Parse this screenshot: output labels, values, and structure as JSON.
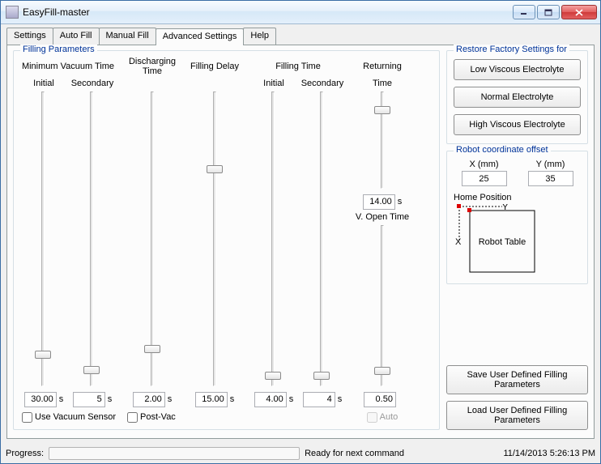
{
  "window": {
    "title": "EasyFill-master"
  },
  "tabs": {
    "items": [
      "Settings",
      "Auto Fill",
      "Manual Fill",
      "Advanced Settings",
      "Help"
    ],
    "active": "Advanced Settings"
  },
  "filling_parameters": {
    "legend": "Filling Parameters",
    "groups": {
      "min_vacuum": {
        "title": "Minimum Vacuum Time",
        "initial_label": "Initial",
        "secondary_label": "Secondary",
        "initial_value": "30.00",
        "secondary_value": "5",
        "unit": "s",
        "checkbox_label": "Use Vacuum Sensor",
        "checkbox_checked": false,
        "initial_slider_pct": 88,
        "secondary_slider_pct": 93
      },
      "discharging": {
        "title": "Discharging Time",
        "value": "2.00",
        "unit": "s",
        "checkbox_label": "Post-Vac",
        "checkbox_checked": false,
        "slider_pct": 86
      },
      "filling_delay": {
        "title": "Filling Delay",
        "value": "15.00",
        "unit": "s",
        "slider_pct": 25
      },
      "filling_time": {
        "title": "Filling Time",
        "initial_label": "Initial",
        "secondary_label": "Secondary",
        "initial_value": "4.00",
        "secondary_value": "4",
        "unit": "s",
        "initial_slider_pct": 95,
        "secondary_slider_pct": 95
      },
      "returning": {
        "title": "Returning",
        "time_label": "Time",
        "time_value": "14.00",
        "time_unit": "s",
        "time_slider_pct": 15,
        "vopen_label": "V. Open Time",
        "vopen_value": "0.50",
        "vopen_slider_pct": 88,
        "auto_label": "Auto",
        "auto_disabled": true
      }
    }
  },
  "restore": {
    "legend": "Restore Factory Settings for",
    "buttons": {
      "low": "Low Viscous Electrolyte",
      "normal": "Normal Electrolyte",
      "high": "High Viscous Electrolyte"
    }
  },
  "offset": {
    "legend": "Robot coordinate offset",
    "x_label": "X (mm)",
    "y_label": "Y (mm)",
    "x_value": "25",
    "y_value": "35",
    "home_label": "Home Position",
    "table_label": "Robot Table",
    "x_axis": "X",
    "y_axis": "Y"
  },
  "user_defined": {
    "save": "Save User Defined Filling Parameters",
    "load": "Load User Defined Filling Parameters"
  },
  "status": {
    "progress_label": "Progress:",
    "message": "Ready for next command",
    "datetime": "11/14/2013 5:26:13 PM"
  }
}
